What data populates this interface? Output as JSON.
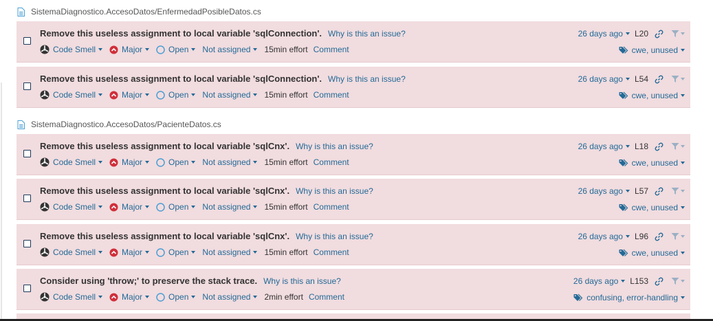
{
  "groups": [
    {
      "file": "SistemaDiagnostico.AccesoDatos/EnfermedadPosibleDatos.cs",
      "issues": [
        {
          "message": "Remove this useless assignment to local variable 'sqlConnection'.",
          "why": "Why is this an issue?",
          "type": "Code Smell",
          "severity": "Major",
          "status": "Open",
          "assignee": "Not assigned",
          "effort": "15min effort",
          "comment": "Comment",
          "date": "26 days ago",
          "line": "L20",
          "tags": "cwe, unused"
        },
        {
          "message": "Remove this useless assignment to local variable 'sqlConnection'.",
          "why": "Why is this an issue?",
          "type": "Code Smell",
          "severity": "Major",
          "status": "Open",
          "assignee": "Not assigned",
          "effort": "15min effort",
          "comment": "Comment",
          "date": "26 days ago",
          "line": "L54",
          "tags": "cwe, unused"
        }
      ]
    },
    {
      "file": "SistemaDiagnostico.AccesoDatos/PacienteDatos.cs",
      "issues": [
        {
          "message": "Remove this useless assignment to local variable 'sqlCnx'.",
          "why": "Why is this an issue?",
          "type": "Code Smell",
          "severity": "Major",
          "status": "Open",
          "assignee": "Not assigned",
          "effort": "15min effort",
          "comment": "Comment",
          "date": "26 days ago",
          "line": "L18",
          "tags": "cwe, unused"
        },
        {
          "message": "Remove this useless assignment to local variable 'sqlCnx'.",
          "why": "Why is this an issue?",
          "type": "Code Smell",
          "severity": "Major",
          "status": "Open",
          "assignee": "Not assigned",
          "effort": "15min effort",
          "comment": "Comment",
          "date": "26 days ago",
          "line": "L57",
          "tags": "cwe, unused"
        },
        {
          "message": "Remove this useless assignment to local variable 'sqlCnx'.",
          "why": "Why is this an issue?",
          "type": "Code Smell",
          "severity": "Major",
          "status": "Open",
          "assignee": "Not assigned",
          "effort": "15min effort",
          "comment": "Comment",
          "date": "26 days ago",
          "line": "L96",
          "tags": "cwe, unused"
        },
        {
          "message": "Consider using 'throw;' to preserve the stack trace.",
          "why": "Why is this an issue?",
          "type": "Code Smell",
          "severity": "Major",
          "status": "Open",
          "assignee": "Not assigned",
          "effort": "2min effort",
          "comment": "Comment",
          "date": "26 days ago",
          "line": "L153",
          "tags": "confusing, error-handling"
        }
      ]
    }
  ],
  "icons": {
    "file": "file-icon",
    "type": "code-smell-icon",
    "severity": "major-severity-icon",
    "status": "open-status-icon",
    "link": "link-icon",
    "filter": "filter-icon",
    "tag": "tag-icon"
  },
  "colors": {
    "issue_background": "#f1dcdf",
    "link": "#236a97",
    "major": "#d02f3a",
    "open": "#4b9fd5"
  }
}
